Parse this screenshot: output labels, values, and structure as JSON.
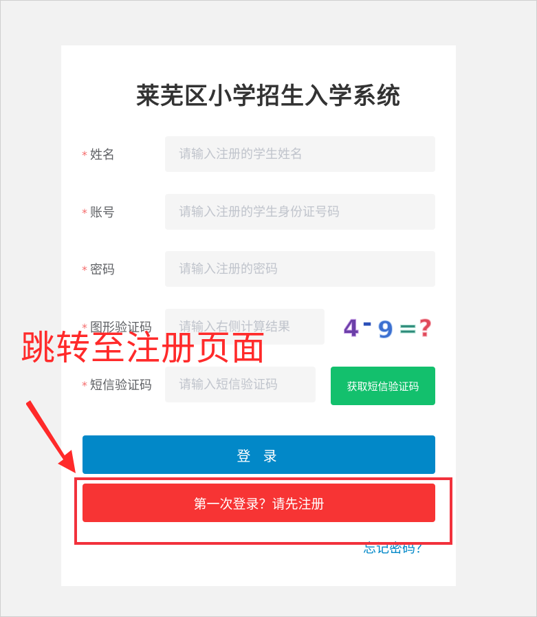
{
  "title": "莱芜区小学招生入学系统",
  "required_mark": "*",
  "form": {
    "name": {
      "label": "姓名",
      "placeholder": "请输入注册的学生姓名"
    },
    "account": {
      "label": "账号",
      "placeholder": "请输入注册的学生身份证号码"
    },
    "password": {
      "label": "密码",
      "placeholder": "请输入注册的密码"
    },
    "captcha": {
      "label": "图形验证码",
      "placeholder": "请输入右侧计算结果",
      "image_text": "4-9=?"
    },
    "sms": {
      "label": "短信验证码",
      "placeholder": "请输入短信验证码",
      "button": "获取短信验证码"
    }
  },
  "buttons": {
    "login": "登 录",
    "register": "第一次登录？请先注册"
  },
  "links": {
    "forgot": "忘记密码？"
  },
  "annotation": {
    "text": "跳转至注册页面",
    "color": "#ff2a2a"
  },
  "colors": {
    "primary": "#0288c8",
    "success": "#13c06d",
    "danger": "#f73434"
  }
}
